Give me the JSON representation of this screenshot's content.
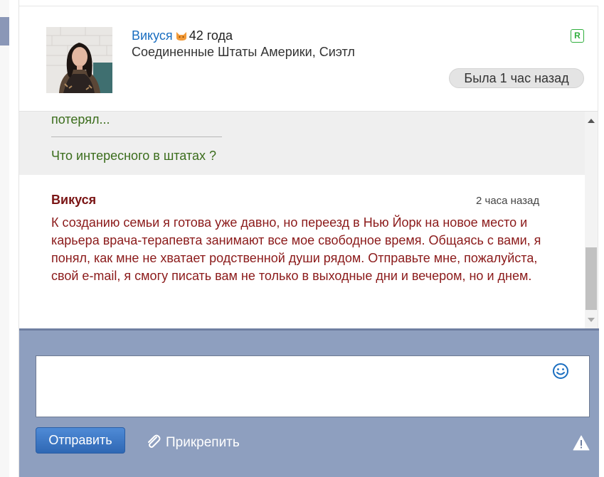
{
  "profile": {
    "name": "Викуся",
    "age": "42 года",
    "location": "Соединенные Штаты Америки, Сиэтл",
    "badge": "R",
    "status": "Была 1 час назад",
    "icons": {
      "zodiac": "cat-icon",
      "badge": "r-badge"
    }
  },
  "chat": {
    "previous_message": {
      "quote_tail": "потерял...",
      "question": "Что интересного в штатах ?"
    },
    "message": {
      "author": "Викуся",
      "time": "2 часа назад",
      "body": "К созданию семьи я готова уже давно, но переезд в Нью Йорк на новое место и карьера врача-терапевта занимают все мое свободное время. Общаясь с вами, я понял, как мне не хватает родственной души рядом. Отправьте мне, пожалуйста, свой e-mail, я смогу писать вам не только в выходные дни и вечером, но и днем."
    }
  },
  "composer": {
    "input_value": "",
    "send_label": "Отправить",
    "attach_label": "Прикрепить",
    "icons": {
      "emoji": "smile-icon",
      "attach": "paperclip-icon",
      "report": "warning-icon"
    }
  },
  "colors": {
    "link": "#1a6ec0",
    "quote_text": "#3b6d1c",
    "author": "#7a1515",
    "message_text": "#8b1a1a",
    "composer_bg": "#8e9fbf",
    "send_button": "#3d79c6",
    "badge_green": "#2fae3c"
  }
}
